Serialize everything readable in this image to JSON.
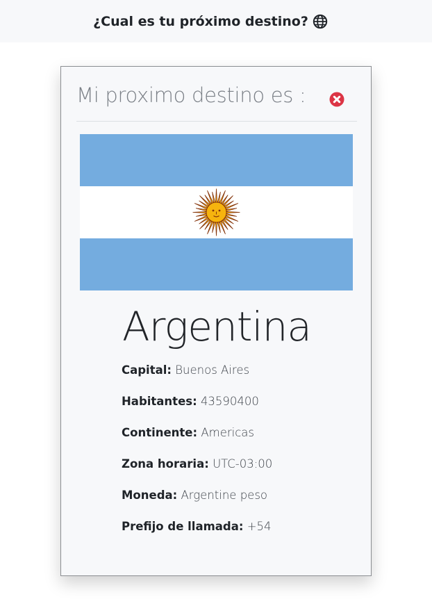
{
  "header": {
    "title": "¿Cual es tu próximo destino?",
    "icon": "globe-icon"
  },
  "card": {
    "title": "Mi proximo destino es :",
    "close_icon": "close-icon",
    "close_color": "#dc3545",
    "flag": {
      "name": "argentina-flag",
      "colors": {
        "stripe": "#74acdf",
        "white": "#ffffff",
        "sun": "#f6b40e",
        "sun_stroke": "#85340a"
      }
    },
    "country": "Argentina",
    "details": [
      {
        "label": "Capital:",
        "value": "Buenos Aires"
      },
      {
        "label": "Habitantes:",
        "value": "43590400"
      },
      {
        "label": "Continente:",
        "value": "Americas"
      },
      {
        "label": "Zona horaria:",
        "value": "UTC-03:00"
      },
      {
        "label": "Moneda:",
        "value": "Argentine peso"
      },
      {
        "label": "Prefijo de llamada:",
        "value": "+54"
      }
    ]
  }
}
